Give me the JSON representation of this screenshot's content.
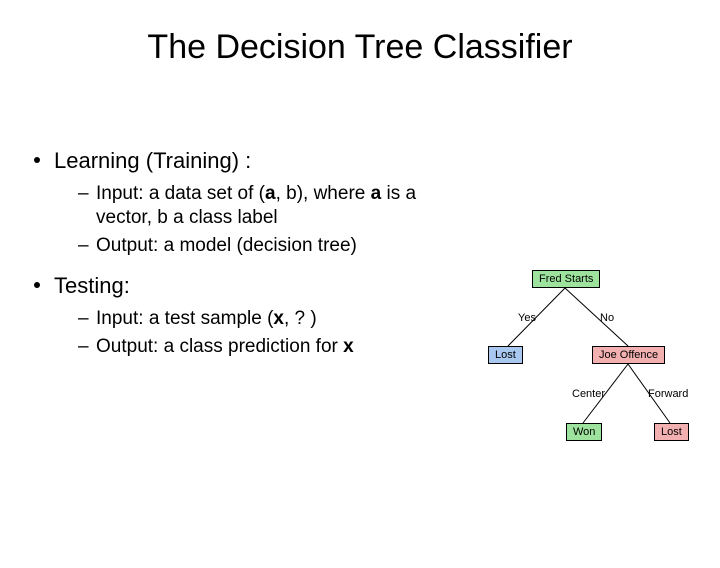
{
  "title": "The Decision Tree Classifier",
  "sections": [
    {
      "heading": "Learning (Training) :",
      "items": [
        {
          "pre": "Input: a data set of (",
          "b1": "a",
          "mid1": ", b), where ",
          "b2": "a",
          "mid2": " is a vector, b a class label",
          "post": ""
        },
        {
          "pre": "Output: a model (decision tree)",
          "b1": "",
          "mid1": "",
          "b2": "",
          "mid2": "",
          "post": ""
        }
      ]
    },
    {
      "heading": "Testing:",
      "items": [
        {
          "pre": "Input: a test sample (",
          "b1": "x",
          "mid1": ", ? )",
          "b2": "",
          "mid2": "",
          "post": ""
        },
        {
          "pre": "Output: a class prediction for ",
          "b1": "x",
          "mid1": "",
          "b2": "",
          "mid2": "",
          "post": ""
        }
      ]
    }
  ],
  "tree": {
    "root": "Fred Starts",
    "rootL": "Yes",
    "rootR": "No",
    "leftLeaf": "Lost",
    "right": "Joe Offence",
    "rightL": "Center",
    "rightR": "Forward",
    "rlLeaf": "Won",
    "rrLeaf": "Lost"
  }
}
